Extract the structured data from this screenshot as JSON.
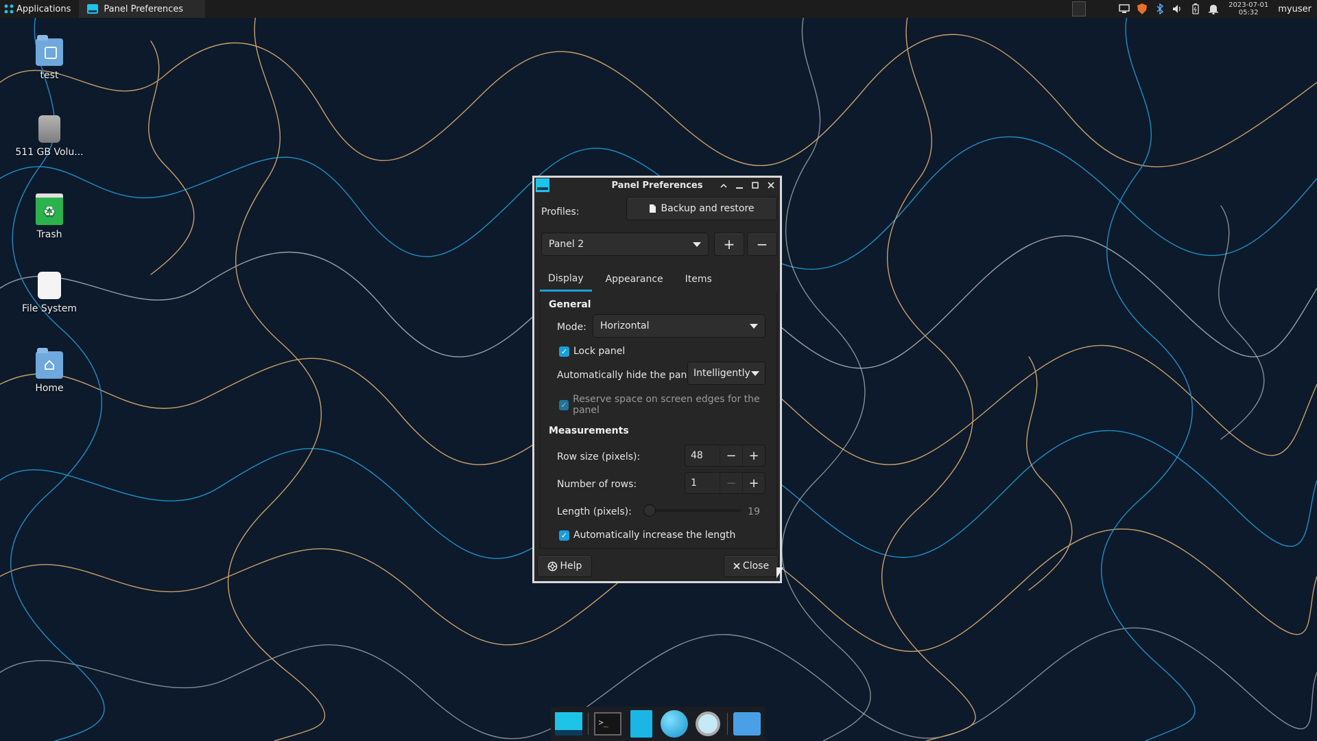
{
  "top_panel": {
    "applications_label": "Applications",
    "task_title": "Panel Preferences",
    "clock_date": "2023-07-01",
    "clock_time": "05:32",
    "username": "myuser",
    "tray_icons": [
      "workspace-icon",
      "network-icon",
      "security-shield-icon",
      "bluetooth-icon",
      "volume-icon",
      "battery-icon",
      "notification-bell-icon"
    ]
  },
  "desktop_icons": [
    {
      "label": "test",
      "icon": "folder-icon"
    },
    {
      "label": "511 GB Volu...",
      "icon": "drive-icon"
    },
    {
      "label": "Trash",
      "icon": "trash-icon"
    },
    {
      "label": "File System",
      "icon": "filesystem-icon"
    },
    {
      "label": "Home",
      "icon": "home-folder-icon"
    }
  ],
  "dialog": {
    "title": "Panel Preferences",
    "profiles_label": "Profiles:",
    "backup_button": "Backup and restore",
    "panel_select": "Panel 2",
    "add_symbol": "+",
    "remove_symbol": "−",
    "tabs": [
      {
        "label": "Display",
        "active": true
      },
      {
        "label": "Appearance",
        "active": false
      },
      {
        "label": "Items",
        "active": false
      }
    ],
    "general_heading": "General",
    "mode_label": "Mode:",
    "mode_value": "Horizontal",
    "lock_panel_label": "Lock panel",
    "lock_panel_checked": true,
    "autohide_label": "Automatically hide the panel:",
    "autohide_value": "Intelligently",
    "reserve_space_label": "Reserve space on screen edges for the panel",
    "reserve_space_checked": true,
    "measurements_heading": "Measurements",
    "row_size_label": "Row size (pixels):",
    "row_size_value": "48",
    "rows_label": "Number of rows:",
    "rows_value": "1",
    "length_label": "Length (pixels):",
    "length_value": "19",
    "length_fraction": 0.0,
    "auto_increase_label": "Automatically increase the length",
    "auto_increase_checked": true,
    "help_button": "Help",
    "close_button": "Close"
  },
  "dock": {
    "items": [
      "panel-icon",
      "terminal-icon",
      "text-editor-icon",
      "web-browser-icon",
      "search-icon",
      "file-manager-icon"
    ],
    "terminal_glyph": ">_"
  },
  "colors": {
    "accent": "#1a9fd9",
    "wallpaper_bg": "#0d1a2b",
    "contour_orange": "#c9a06a",
    "contour_blue": "#1f8fc8"
  }
}
